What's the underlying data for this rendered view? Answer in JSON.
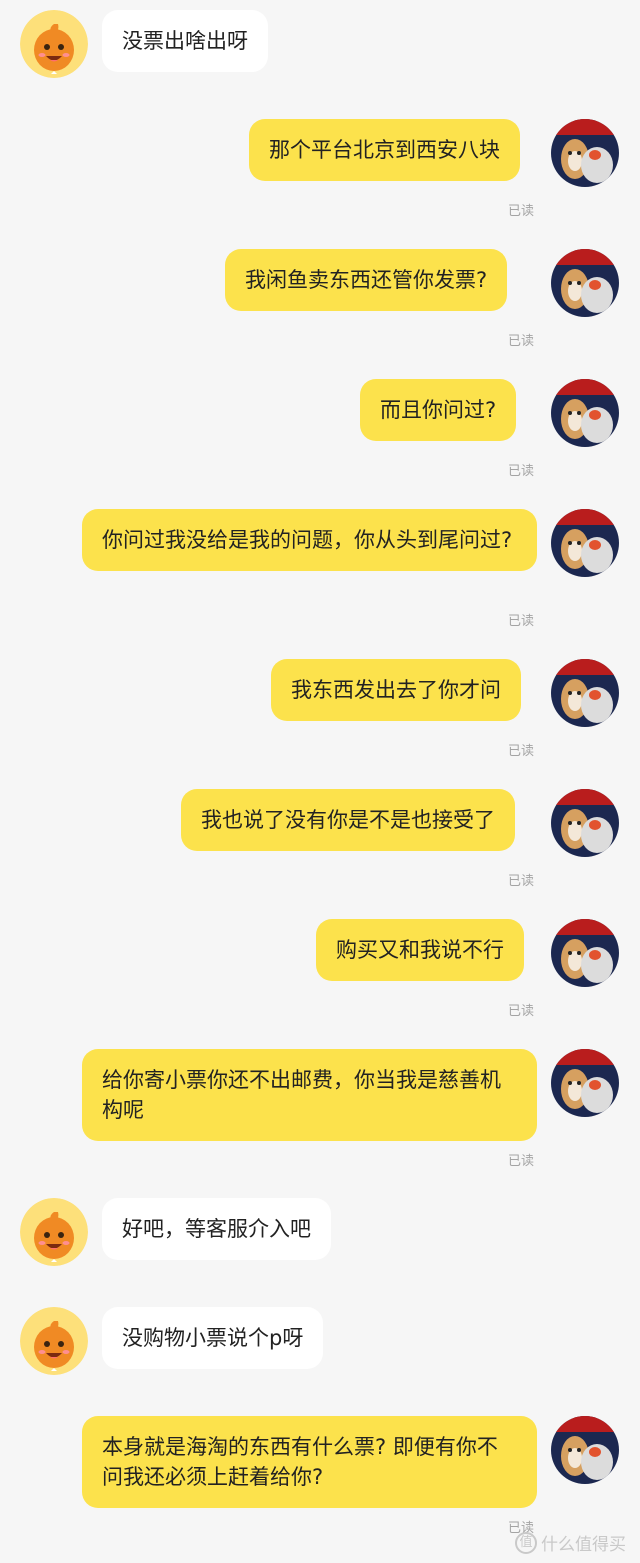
{
  "chat": {
    "read_label": "已读",
    "messages": [
      {
        "side": "left",
        "text": "没票出啥出呀"
      },
      {
        "side": "right",
        "text": "那个平台北京到西安八块"
      },
      {
        "side": "right",
        "text": "我闲鱼卖东西还管你发票?"
      },
      {
        "side": "right",
        "text": "而且你问过?"
      },
      {
        "side": "right",
        "text": "你问过我没给是我的问题，你从头到尾问过?"
      },
      {
        "side": "right",
        "text": "我东西发出去了你才问"
      },
      {
        "side": "right",
        "text": "我也说了没有你是不是也接受了"
      },
      {
        "side": "right",
        "text": "购买又和我说不行"
      },
      {
        "side": "right",
        "text": "给你寄小票你还不出邮费，你当我是慈善机构呢"
      },
      {
        "side": "left",
        "text": "好吧，等客服介入吧"
      },
      {
        "side": "left",
        "text": "没购物小票说个p呀"
      },
      {
        "side": "right",
        "text": "本身就是海淘的东西有什么票? 即便有你不问我还必须上赶着给你?"
      }
    ]
  },
  "watermark": {
    "icon_glyph": "值",
    "text": "什么值得买"
  }
}
